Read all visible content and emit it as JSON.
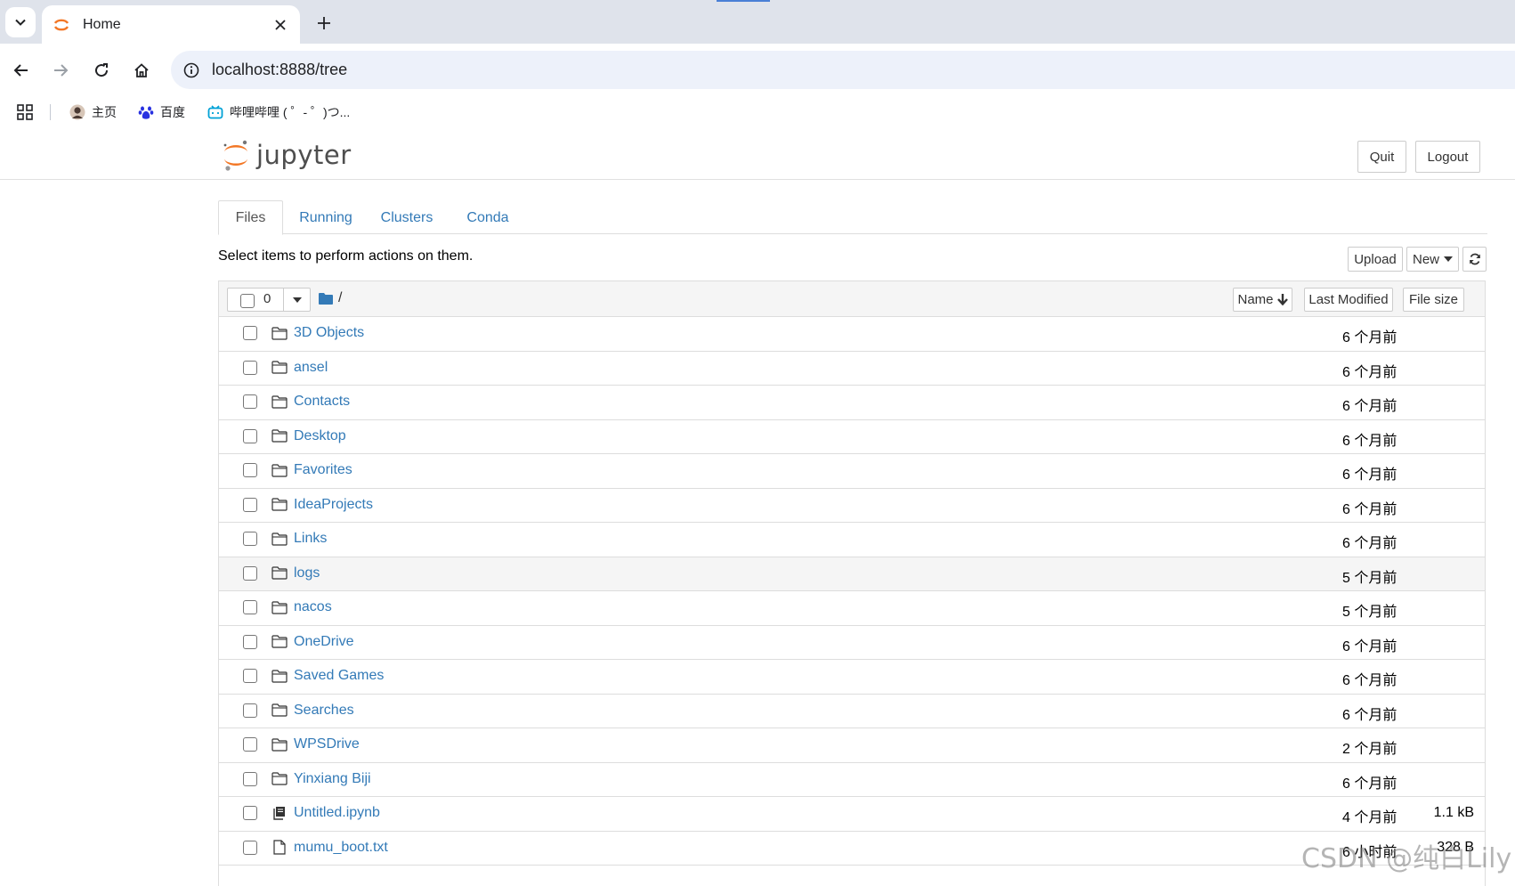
{
  "browser": {
    "tab_title": "Home",
    "url": "localhost:8888/tree",
    "bookmarks": [
      {
        "label": "主页",
        "icon": "avatar-icon"
      },
      {
        "label": "百度",
        "icon": "baidu-paw-icon"
      },
      {
        "label": "哔哩哔哩 ( ゜- ゜)つ...",
        "icon": "bilibili-tv-icon"
      }
    ]
  },
  "jupyter": {
    "logo_text": "jupyter",
    "quit_label": "Quit",
    "logout_label": "Logout",
    "tabs": [
      {
        "label": "Files",
        "active": true
      },
      {
        "label": "Running",
        "active": false
      },
      {
        "label": "Clusters",
        "active": false
      },
      {
        "label": "Conda",
        "active": false
      }
    ],
    "select_hint": "Select items to perform actions on them.",
    "upload_label": "Upload",
    "new_label": "New",
    "selected_count": "0",
    "breadcrumb_path": "/",
    "columns": {
      "name": "Name",
      "last_modified": "Last Modified",
      "file_size": "File size"
    },
    "items": [
      {
        "name": "3D Objects",
        "type": "folder",
        "modified": "6 个月前",
        "size": ""
      },
      {
        "name": "ansel",
        "type": "folder",
        "modified": "6 个月前",
        "size": ""
      },
      {
        "name": "Contacts",
        "type": "folder",
        "modified": "6 个月前",
        "size": ""
      },
      {
        "name": "Desktop",
        "type": "folder",
        "modified": "6 个月前",
        "size": ""
      },
      {
        "name": "Favorites",
        "type": "folder",
        "modified": "6 个月前",
        "size": ""
      },
      {
        "name": "IdeaProjects",
        "type": "folder",
        "modified": "6 个月前",
        "size": ""
      },
      {
        "name": "Links",
        "type": "folder",
        "modified": "6 个月前",
        "size": ""
      },
      {
        "name": "logs",
        "type": "folder",
        "modified": "5 个月前",
        "size": ""
      },
      {
        "name": "nacos",
        "type": "folder",
        "modified": "5 个月前",
        "size": ""
      },
      {
        "name": "OneDrive",
        "type": "folder",
        "modified": "6 个月前",
        "size": ""
      },
      {
        "name": "Saved Games",
        "type": "folder",
        "modified": "6 个月前",
        "size": ""
      },
      {
        "name": "Searches",
        "type": "folder",
        "modified": "6 个月前",
        "size": ""
      },
      {
        "name": "WPSDrive",
        "type": "folder",
        "modified": "2 个月前",
        "size": ""
      },
      {
        "name": "Yinxiang Biji",
        "type": "folder",
        "modified": "6 个月前",
        "size": ""
      },
      {
        "name": "Untitled.ipynb",
        "type": "notebook",
        "modified": "4 个月前",
        "size": "1.1 kB"
      },
      {
        "name": "mumu_boot.txt",
        "type": "file",
        "modified": "6 小时前",
        "size": "328 B"
      }
    ]
  },
  "watermark": "CSDN @纯白Lily"
}
